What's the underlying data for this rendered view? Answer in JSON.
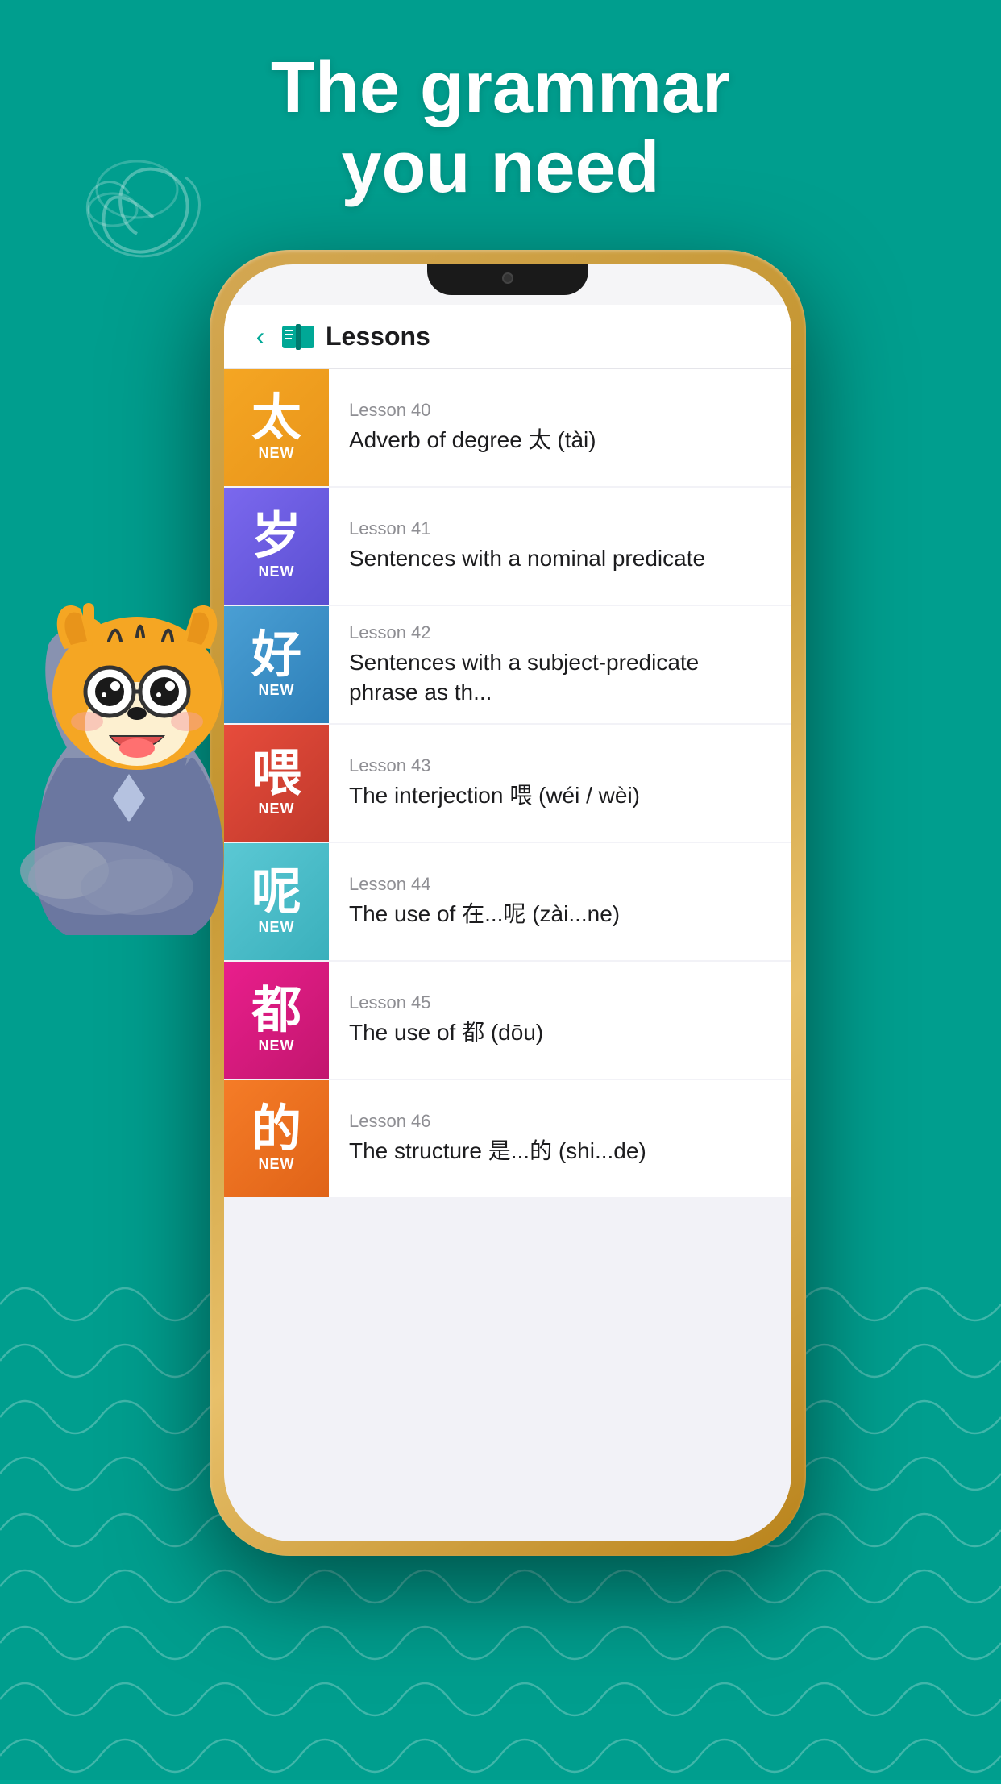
{
  "header": {
    "line1": "The grammar",
    "line2": "you need"
  },
  "nav": {
    "back_label": "‹",
    "title": "Lessons"
  },
  "lessons": [
    {
      "id": 40,
      "chinese": "太",
      "color_class": "lesson-40",
      "number_label": "Lesson 40",
      "title": "Adverb of degree 太 (tài)",
      "badge": "NEW"
    },
    {
      "id": 41,
      "chinese": "岁",
      "color_class": "lesson-41",
      "number_label": "Lesson 41",
      "title": "Sentences with a nominal predicate",
      "badge": "NEW"
    },
    {
      "id": 42,
      "chinese": "好",
      "color_class": "lesson-42",
      "number_label": "Lesson 42",
      "title": "Sentences with a subject-predicate phrase as th...",
      "badge": "NEW"
    },
    {
      "id": 43,
      "chinese": "喂",
      "color_class": "lesson-43",
      "number_label": "Lesson 43",
      "title": "The interjection 喂 (wéi / wèi)",
      "badge": "NEW"
    },
    {
      "id": 44,
      "chinese": "呢",
      "color_class": "lesson-44",
      "number_label": "Lesson 44",
      "title": "The use of 在...呢 (zài...ne)",
      "badge": "NEW"
    },
    {
      "id": 45,
      "chinese": "都",
      "color_class": "lesson-45",
      "number_label": "Lesson 45",
      "title": "The use of 都 (dōu)",
      "badge": "NEW"
    },
    {
      "id": 46,
      "chinese": "的",
      "color_class": "lesson-46",
      "number_label": "Lesson 46",
      "title": "The structure 是...的 (shi...de)",
      "badge": "NEW"
    }
  ]
}
